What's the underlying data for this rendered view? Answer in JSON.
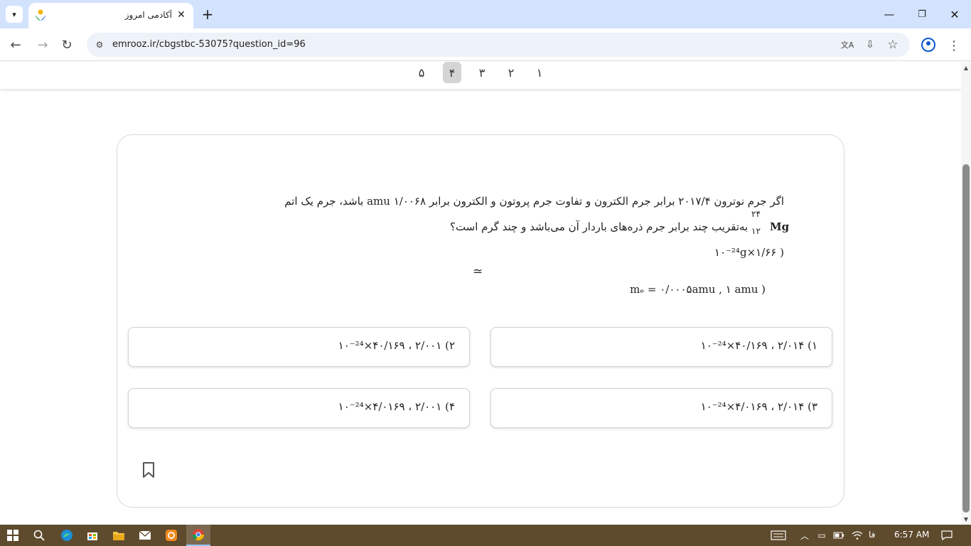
{
  "browser": {
    "tab_title": "آکادمی امروز",
    "url": "emrooz.ir/cbgstbc-53075?question_id=96",
    "icons": {
      "tab_search": "chevron-down-icon",
      "tab_close": "close-icon",
      "new_tab": "plus-icon",
      "minimize": "minimize-icon",
      "maximize": "restore-icon",
      "close": "close-icon",
      "back": "arrow-left-icon",
      "forward": "arrow-right-icon",
      "reload": "reload-icon",
      "site_info": "tune-icon",
      "translate": "translate-icon",
      "install": "install-icon",
      "bookmark": "star-icon",
      "profile": "profile-icon",
      "menu": "more-vert-icon"
    }
  },
  "pager": {
    "pages": [
      "۱",
      "۲",
      "۳",
      "۴",
      "۵"
    ],
    "active_index": 3,
    "active_color": "#d4d4d4"
  },
  "question": {
    "line1": "اگر جرم نوترون ۲۰۱۷/۴ برابر جرم الکترون و تفاوت جرم پروتون و الکترون برابر amu ۱/۰۰۶۸ باشد، جرم یک اتم",
    "nuclide_mass_number": "۲۴",
    "nuclide_atomic_number": "۱۲",
    "nuclide_symbol": "Mg",
    "line2": "به‌تقریب چند برابر جرم ذره‌های باردار آن می‌باشد و چند گرم است؟",
    "line3": "( ۱/۶۶×۱۰⁻²⁴g",
    "line4": "≃",
    "line5": "( mₑ = ۰/۰۰۰۵amu , ۱ amu"
  },
  "options": [
    {
      "number": "۱)",
      "text": "۲/۰۱۴ ، ۴۰/۱۶۹×۱۰⁻²⁴"
    },
    {
      "number": "۲)",
      "text": "۲/۰۰۱ ، ۴۰/۱۶۹×۱۰⁻²⁴"
    },
    {
      "number": "۳)",
      "text": "۲/۰۱۴ ، ۴/۰۱۶۹×۱۰⁻²⁴"
    },
    {
      "number": "۴)",
      "text": "۲/۰۰۱ ، ۴/۰۱۶۹×۱۰⁻²⁴"
    }
  ],
  "bookmark_icon": "bookmark-outline-icon",
  "taskbar": {
    "lang": "فا",
    "clock": "6:57 AM",
    "background": "#5e4a2c",
    "icons": [
      "windows-start-icon",
      "search-icon",
      "edge-icon",
      "store-icon",
      "file-explorer-icon",
      "mail-icon",
      "app-icon",
      "chrome-icon"
    ],
    "tray_icons": [
      "keyboard-icon",
      "chevron-up-icon",
      "camera-icon",
      "battery-icon",
      "wifi-icon",
      "volume-icon",
      "notification-icon"
    ]
  }
}
